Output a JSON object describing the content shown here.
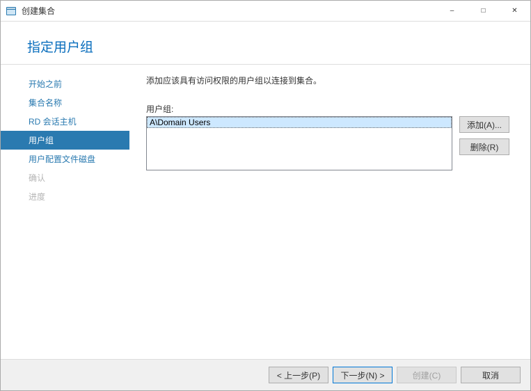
{
  "window": {
    "title": "创建集合"
  },
  "header": {
    "title": "指定用户组"
  },
  "sidebar": {
    "items": [
      {
        "label": "开始之前",
        "state": "normal"
      },
      {
        "label": "集合名称",
        "state": "normal"
      },
      {
        "label": "RD 会话主机",
        "state": "normal"
      },
      {
        "label": "用户组",
        "state": "active"
      },
      {
        "label": "用户配置文件磁盘",
        "state": "normal"
      },
      {
        "label": "确认",
        "state": "disabled"
      },
      {
        "label": "进度",
        "state": "disabled"
      }
    ]
  },
  "main": {
    "instruction": "添加应该具有访问权限的用户组以连接到集合。",
    "list_label": "用户组:",
    "items": [
      {
        "text": "A\\Domain Users",
        "selected": true
      }
    ],
    "add_label": "添加(A)...",
    "remove_label": "删除(R)"
  },
  "footer": {
    "prev": "< 上一步(P)",
    "next": "下一步(N) >",
    "create": "创建(C)",
    "cancel": "取消"
  }
}
